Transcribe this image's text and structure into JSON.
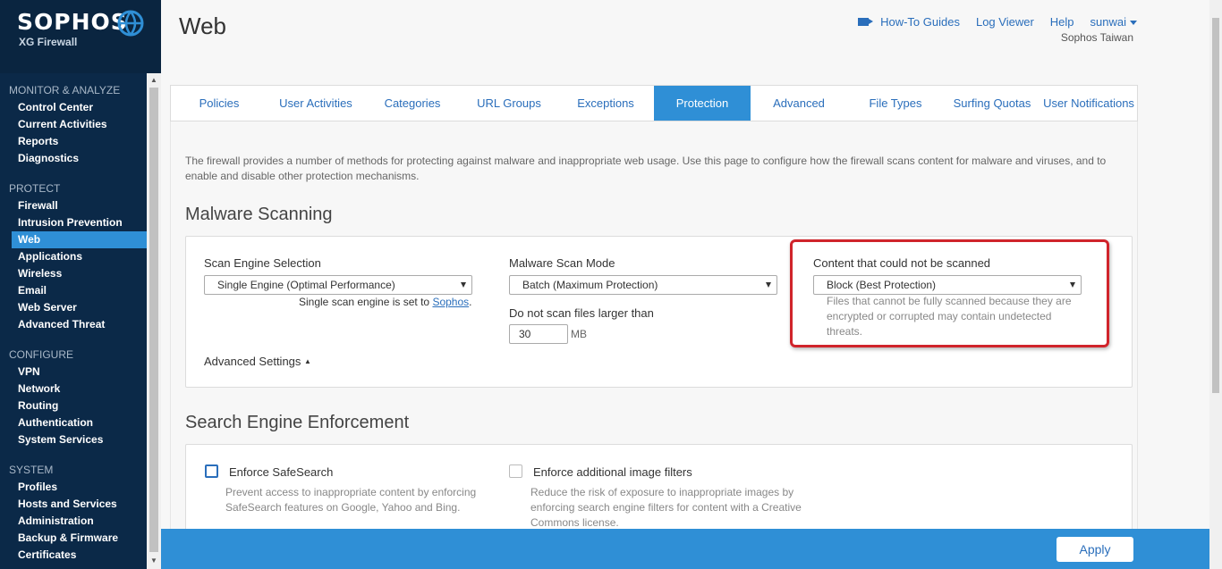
{
  "brand": {
    "name": "SOPHOS",
    "product": "XG Firewall"
  },
  "page": {
    "title": "Web"
  },
  "top_links": {
    "guides": "How-To Guides",
    "log_viewer": "Log Viewer",
    "help": "Help",
    "user": "sunwai",
    "org": "Sophos Taiwan"
  },
  "nav": {
    "sections": [
      {
        "title": "MONITOR & ANALYZE",
        "items": [
          "Control Center",
          "Current Activities",
          "Reports",
          "Diagnostics"
        ]
      },
      {
        "title": "PROTECT",
        "items": [
          "Firewall",
          "Intrusion Prevention",
          "Web",
          "Applications",
          "Wireless",
          "Email",
          "Web Server",
          "Advanced Threat"
        ]
      },
      {
        "title": "CONFIGURE",
        "items": [
          "VPN",
          "Network",
          "Routing",
          "Authentication",
          "System Services"
        ]
      },
      {
        "title": "SYSTEM",
        "items": [
          "Profiles",
          "Hosts and Services",
          "Administration",
          "Backup & Firmware",
          "Certificates"
        ]
      }
    ],
    "active": "Web"
  },
  "tabs": [
    "Policies",
    "User Activities",
    "Categories",
    "URL Groups",
    "Exceptions",
    "Protection",
    "Advanced",
    "File Types",
    "Surfing Quotas",
    "User Notifications"
  ],
  "active_tab": "Protection",
  "intro": "The firewall provides a number of methods for protecting against malware and inappropriate web usage. Use this page to configure how the firewall scans content for malware and viruses, and to enable and disable other protection mechanisms.",
  "malware": {
    "title": "Malware Scanning",
    "engine_label": "Scan Engine Selection",
    "engine_value": "Single Engine (Optimal Performance)",
    "engine_hint_prefix": "Single scan engine is set to",
    "engine_hint_link": "Sophos",
    "engine_hint_suffix": ".",
    "mode_label": "Malware Scan Mode",
    "mode_value": "Batch (Maximum Protection)",
    "size_label": "Do not scan files larger than",
    "size_value": "30",
    "size_unit": "MB",
    "unscanned_label": "Content that could not be scanned",
    "unscanned_value": "Block (Best Protection)",
    "unscanned_hint": "Files that cannot be fully scanned because they are encrypted or corrupted may contain undetected threats.",
    "advanced": "Advanced Settings"
  },
  "search": {
    "title": "Search Engine Enforcement",
    "safesearch_label": "Enforce SafeSearch",
    "safesearch_hint": "Prevent access to inappropriate content by enforcing SafeSearch features on Google, Yahoo and Bing.",
    "image_label": "Enforce additional image filters",
    "image_hint": "Reduce the risk of exposure to inappropriate images by enforcing search engine filters for content with a Creative Commons license."
  },
  "apply": "Apply",
  "colors": {
    "sidebar": "#0a2540",
    "accent": "#2f8fd6",
    "highlight": "#d0242b"
  }
}
